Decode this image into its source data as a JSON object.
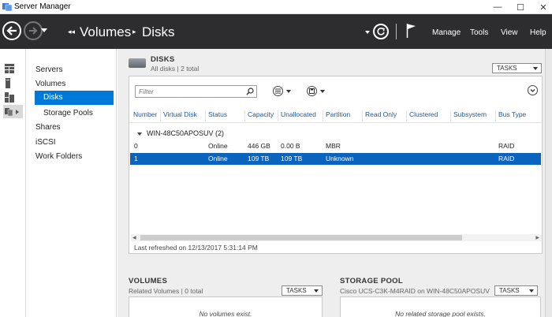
{
  "window": {
    "title": "Server Manager",
    "minimize": "—",
    "maximize": "☐",
    "close": "✕"
  },
  "header": {
    "breadcrumb_prefix": "◂◂",
    "breadcrumb": [
      "Volumes",
      "Disks"
    ],
    "menu": [
      "Manage",
      "Tools",
      "View",
      "Help"
    ]
  },
  "nav": {
    "items": [
      {
        "label": "Servers"
      },
      {
        "label": "Volumes"
      },
      {
        "label": "Disks",
        "selected": true
      },
      {
        "label": "Storage Pools"
      },
      {
        "label": "Shares"
      },
      {
        "label": "iSCSI"
      },
      {
        "label": "Work Folders"
      }
    ]
  },
  "disks": {
    "title": "DISKS",
    "subtitle": "All disks | 2 total",
    "tasks_label": "TASKS",
    "filter_placeholder": "Filter",
    "columns": [
      "Number",
      "Virtual Disk",
      "Status",
      "Capacity",
      "Unallocated",
      "Partition",
      "Read Only",
      "Clustered",
      "Subsystem",
      "Bus Type"
    ],
    "group": "WIN-48C50APOSUV (2)",
    "rows": [
      {
        "number": "0",
        "virtual_disk": "",
        "status": "Online",
        "capacity": "446 GB",
        "unallocated": "0.00 B",
        "partition": "MBR",
        "read_only": "",
        "clustered": "",
        "subsystem": "",
        "bus_type": "RAID",
        "selected": false
      },
      {
        "number": "1",
        "virtual_disk": "",
        "status": "Online",
        "capacity": "109 TB",
        "unallocated": "109 TB",
        "partition": "Unknown",
        "read_only": "",
        "clustered": "",
        "subsystem": "",
        "bus_type": "RAID",
        "selected": true
      }
    ],
    "last_refreshed": "Last refreshed on 12/13/2017 5:31:14 PM"
  },
  "volumes": {
    "title": "VOLUMES",
    "subtitle": "Related Volumes | 0 total",
    "tasks_label": "TASKS",
    "empty_text": "No volumes exist."
  },
  "storage_pool": {
    "title": "STORAGE POOL",
    "subtitle": "Cisco UCS-C3K-M4RAID on WIN-48C50APOSUV",
    "tasks_label": "TASKS",
    "empty_text": "No related storage pool exists."
  },
  "colors": {
    "header_bg": "#2d2d30",
    "selection": "#0078d7",
    "row_selection": "#0a64bd",
    "column_header_text": "#1e5a9c"
  }
}
